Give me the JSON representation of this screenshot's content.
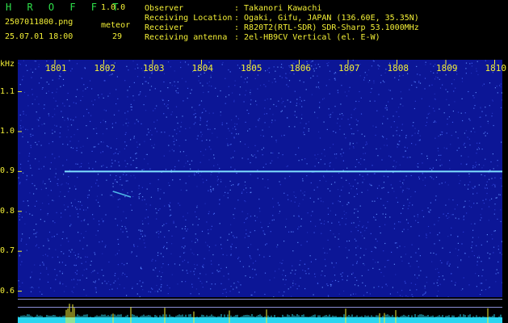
{
  "header": {
    "app_name": "H R O F F T",
    "version": "1.0.0",
    "file_name": "2507011800.png",
    "detect_label": "meteor",
    "datetime": "25.07.01 18:00",
    "meteor_count": "29",
    "info": [
      {
        "label": "Observer",
        "value": ": Takanori Kawachi"
      },
      {
        "label": "Receiving Location",
        "value": ": Ogaki, Gifu, JAPAN (136.60E, 35.35N)"
      },
      {
        "label": "Receiver",
        "value": ": R820T2(RTL-SDR) SDR-Sharp 53.1000MHz"
      },
      {
        "label": "Receiving antenna",
        "value": ": 2el-HB9CV Vertical (el. E-W)"
      }
    ]
  },
  "colors": {
    "background": "#000000",
    "spectrogram": "#0c1696",
    "text_yellow": "#f3ef36",
    "logo_green": "#2ee04a",
    "carrier": "#7fe0ff"
  },
  "chart_data": {
    "type": "heatmap",
    "x_unit": "",
    "y_unit": "kHz",
    "x_ticks": [
      "1801",
      "1802",
      "1803",
      "1804",
      "1805",
      "1806",
      "1807",
      "1808",
      "1809",
      "1810"
    ],
    "y_ticks": [
      "1.1",
      "1.0",
      "0.9",
      "0.8",
      "0.7",
      "0.6"
    ],
    "y_tick_values": [
      1.1,
      1.0,
      0.9,
      0.8,
      0.7,
      0.6
    ],
    "ylim": [
      0.585,
      1.18
    ],
    "carrier_khz": 0.9
  }
}
